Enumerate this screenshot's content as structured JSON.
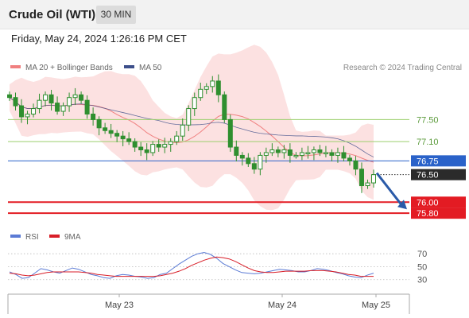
{
  "header": {
    "title": "Crude Oil (WTI)",
    "interval": "30 MIN"
  },
  "datetime": "Friday, May 24, 2024 1:26:16 PM CET",
  "legend": {
    "ma20_bb": "MA 20 + Bollinger Bands",
    "ma50": "MA 50",
    "rsi": "RSI",
    "ma9": "9MA"
  },
  "credit": "Research © 2024 Trading Central",
  "colors": {
    "ma20": "#f08080",
    "bb_fill": "#fbd7d7",
    "ma50": "#3d4f8a",
    "candle": "#2f8f2f",
    "support": "#e31b23",
    "pivot": "#2a62c9",
    "resistance": "#9bcf6e",
    "price_tag": "#2b2b2b",
    "rsi": "#5b7bd5",
    "ma9": "#d81e28",
    "arrow": "#2a5aa8"
  },
  "chart_data": {
    "type": "candlestick",
    "title": "Crude Oil (WTI)",
    "interval": "30 MIN",
    "x_ticks": [
      "May 23",
      "May 24",
      "May 25"
    ],
    "levels": [
      {
        "label": "77.50",
        "value": 77.5,
        "kind": "resistance"
      },
      {
        "label": "77.10",
        "value": 77.1,
        "kind": "resistance"
      },
      {
        "label": "76.75",
        "value": 76.75,
        "kind": "pivot"
      },
      {
        "label": "76.50",
        "value": 76.5,
        "kind": "last_price"
      },
      {
        "label": "76.00",
        "value": 76.0,
        "kind": "support"
      },
      {
        "label": "75.80",
        "value": 75.8,
        "kind": "support"
      }
    ],
    "ylim": [
      75.6,
      78.3
    ],
    "candles_close": [
      77.9,
      77.75,
      77.55,
      77.6,
      77.7,
      77.85,
      77.95,
      77.8,
      77.65,
      77.75,
      77.9,
      77.95,
      77.85,
      77.6,
      77.5,
      77.35,
      77.3,
      77.25,
      77.2,
      77.15,
      77.1,
      77.0,
      76.95,
      76.9,
      77.05,
      77.0,
      77.05,
      77.1,
      77.2,
      77.4,
      77.7,
      77.9,
      78.05,
      78.1,
      78.2,
      77.95,
      77.5,
      77.0,
      76.85,
      76.8,
      76.7,
      76.6,
      76.85,
      76.9,
      76.95,
      76.9,
      76.95,
      76.85,
      76.85,
      76.9,
      76.9,
      76.95,
      76.9,
      76.9,
      76.85,
      76.9,
      76.8,
      76.75,
      76.6,
      76.3,
      76.35,
      76.5
    ],
    "rsi": {
      "ticks": [
        70,
        50,
        30
      ],
      "ylim": [
        10,
        85
      ],
      "values": [
        42,
        38,
        32,
        33,
        40,
        47,
        45,
        42,
        40,
        44,
        48,
        46,
        42,
        38,
        36,
        33,
        32,
        36,
        38,
        37,
        35,
        34,
        32,
        33,
        38,
        40,
        47,
        54,
        60,
        66,
        70,
        72,
        69,
        63,
        55,
        50,
        45,
        41,
        40,
        39,
        40,
        42,
        44,
        46,
        45,
        44,
        42,
        42,
        44,
        47,
        46,
        44,
        41,
        39,
        36,
        34,
        33,
        37,
        40
      ],
      "ma9": [
        40,
        39,
        37,
        36,
        37,
        39,
        41,
        42,
        42,
        42,
        42,
        42,
        41,
        40,
        38,
        37,
        36,
        35,
        35,
        35,
        35,
        35,
        35,
        35,
        36,
        38,
        40,
        43,
        47,
        52,
        56,
        60,
        63,
        65,
        64,
        62,
        58,
        53,
        48,
        44,
        42,
        41,
        41,
        42,
        43,
        43,
        43,
        43,
        44,
        44,
        44,
        43,
        42,
        40,
        38,
        37,
        35,
        35,
        35
      ]
    }
  }
}
